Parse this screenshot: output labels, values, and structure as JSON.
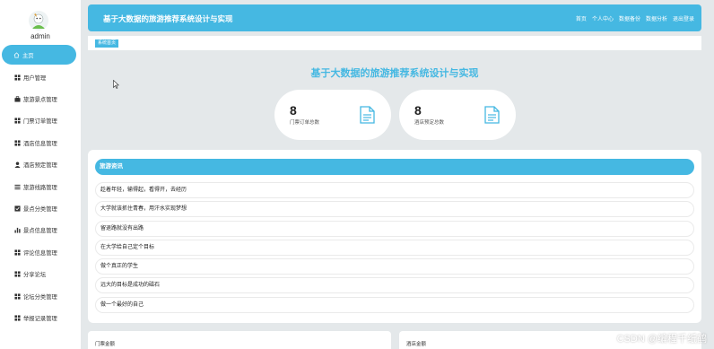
{
  "sidebar": {
    "username": "admin",
    "items": [
      {
        "label": "主页",
        "icon": "home-icon",
        "active": true
      },
      {
        "label": "用户管理",
        "icon": "grid-icon"
      },
      {
        "label": "旅游景点管理",
        "icon": "briefcase-icon"
      },
      {
        "label": "门票订单管理",
        "icon": "grid-icon"
      },
      {
        "label": "酒店信息管理",
        "icon": "grid-icon"
      },
      {
        "label": "酒店预定管理",
        "icon": "user-icon"
      },
      {
        "label": "旅游线路管理",
        "icon": "list-icon"
      },
      {
        "label": "景点分类管理",
        "icon": "checkbox-icon"
      },
      {
        "label": "景点信息管理",
        "icon": "bar-chart-icon"
      },
      {
        "label": "评论信息管理",
        "icon": "grid-icon"
      },
      {
        "label": "分享论坛",
        "icon": "grid-icon"
      },
      {
        "label": "论坛分类管理",
        "icon": "grid-icon"
      },
      {
        "label": "举报记录管理",
        "icon": "grid-icon"
      }
    ]
  },
  "header": {
    "title": "基于大数据的旅游推荐系统设计与实现",
    "nav": [
      "首页",
      "个人中心",
      "数据备份",
      "数据分析",
      "退出登录"
    ]
  },
  "breadcrumb": "系统首页",
  "main": {
    "title": "基于大数据的旅游推荐系统设计与实现",
    "stats": [
      {
        "value": "8",
        "label": "门票订单总数"
      },
      {
        "value": "8",
        "label": "酒店预定总数"
      }
    ]
  },
  "news": {
    "heading": "旅游资讯",
    "items": [
      "趁着年轻，输得起，看得开，去经历",
      "大学就该抓住青春，用汗水实现梦想",
      "留退路就没有出路",
      "在大学给自己定个目标",
      "做个真正的学生",
      "远大的目标是成功的磁石",
      "做一个最好的自己"
    ]
  },
  "bottom": {
    "left_label": "门票金额",
    "right_label": "酒店金额"
  },
  "watermark": "CSDN @编程千纸鹤",
  "colors": {
    "accent": "#45b8e2",
    "background": "#e4e8ea",
    "panel": "#ffffff"
  }
}
